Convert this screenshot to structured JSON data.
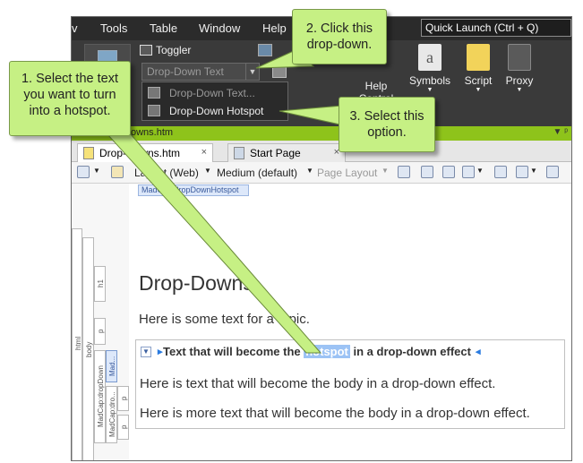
{
  "menubar": {
    "items": [
      "v",
      "Tools",
      "Table",
      "Window",
      "Help"
    ],
    "quick_launch_placeholder": "Quick Launch (Ctrl + Q)"
  },
  "ribbon": {
    "toggler_label": "Toggler",
    "dropdown_combo_value": "Drop-Down Text",
    "dropdown_menu": {
      "items": [
        "Drop-Down Text...",
        "Drop-Down Hotspot"
      ]
    },
    "buttons": {
      "help_control": "Help Control",
      "symbols": "Symbols",
      "script": "Script",
      "proxy": "Proxy"
    }
  },
  "panel": {
    "title": "owns.htm"
  },
  "tabs": [
    {
      "label": "Drop-Downs.htm",
      "close": "×"
    },
    {
      "label": "Start Page",
      "close": "×"
    }
  ],
  "toolbar": {
    "layout": "Layout (Web)",
    "medium": "Medium (default)",
    "page_layout": "Page Layout"
  },
  "editor": {
    "mc_tag": "MadCap:dropDownHotspot",
    "tag_labels": [
      "html",
      "body",
      "h1",
      "p",
      "MadCap:dropDown",
      "Mad...",
      "MadCap:dro...",
      "p",
      "p"
    ],
    "heading": "Drop-Downs",
    "intro": "Here is some text for a topic.",
    "dd_head_before": "Text that will become the ",
    "dd_head_hotspot": "hotspot",
    "dd_head_after": " in a drop-down effect",
    "body1": "Here is text that will become the body in a drop-down effect.",
    "body2": "Here is more text that will become the body in a drop-down effect."
  },
  "callouts": {
    "step1": "1. Select the text you want to turn into a hotspot.",
    "step2": "2. Click this drop-down.",
    "step3": "3. Select this option."
  },
  "colors": {
    "callout_fill": "#c6f084",
    "panel_accent": "#8ec31b",
    "selection": "#9cc3f5"
  }
}
